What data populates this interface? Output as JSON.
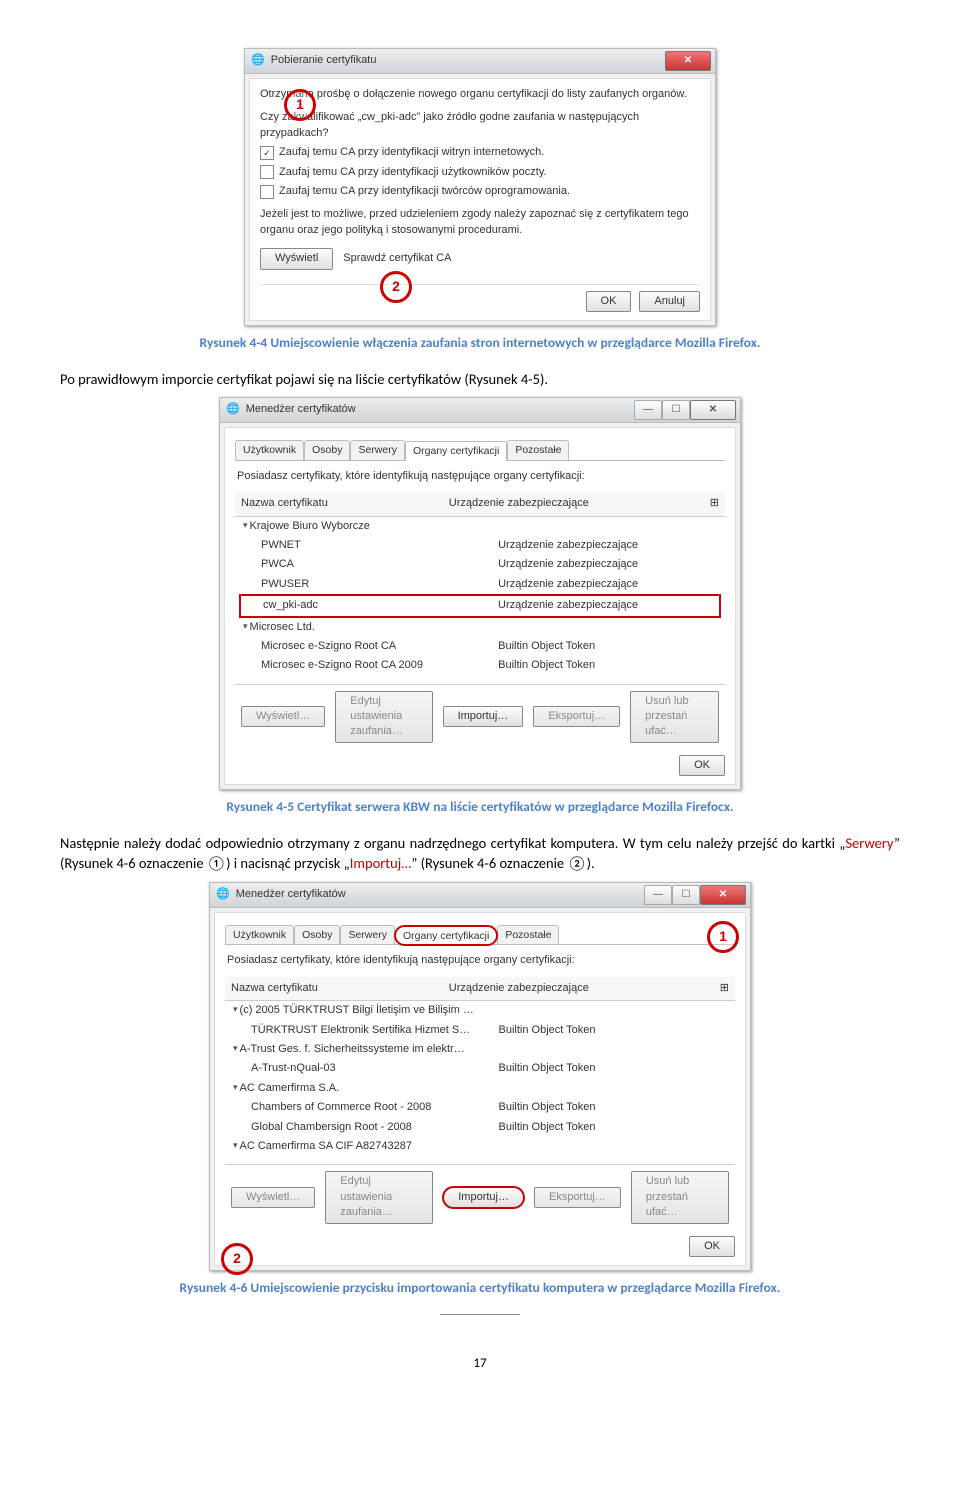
{
  "dialog1": {
    "title": "Pobieranie certyfikatu",
    "intro": "Otrzymano prośbę o dołączenie nowego organu certyfikacji do listy zaufanych organów.",
    "question": "Czy zakwalifikować „cw_pki-adc” jako źródło godne zaufania w następujących przypadkach?",
    "chk1": "Zaufaj temu CA przy identyfikacji witryn internetowych.",
    "chk2": "Zaufaj temu CA przy identyfikacji użytkowników poczty.",
    "chk3": "Zaufaj temu CA przy identyfikacji twórców oprogramowania.",
    "warn": "Jeżeli jest to możliwe, przed udzieleniem zgody należy zapoznać się z certyfikatem tego organu oraz jego polityką i stosowanymi procedurami.",
    "viewBtn": "Wyświetl",
    "verifyBtn": "Sprawdź certyfikat CA",
    "ok": "OK",
    "cancel": "Anuluj",
    "circle1": "1",
    "circle2": "2"
  },
  "caption1": "Rysunek 4-4 Umiejscowienie włączenia zaufania stron internetowych w przeglądarce Mozilla Firefox.",
  "para1": "Po prawidłowym imporcie certyfikat pojawi się na liście certyfikatów (Rysunek 4-5).",
  "dialog2": {
    "title": "Menedżer certyfikatów",
    "tabs": [
      "Użytkownik",
      "Osoby",
      "Serwery",
      "Organy certyfikacji",
      "Pozostałe"
    ],
    "desc": "Posiadasz certyfikaty, które identyfikują następujące organy certyfikacji:",
    "h1": "Nazwa certyfikatu",
    "h2": "Urządzenie zabezpieczające",
    "groups": [
      {
        "name": "Krajowe Biuro Wyborcze",
        "open": true,
        "items": [
          [
            "PWNET",
            "Urządzenie zabezpieczające"
          ],
          [
            "PWCA",
            "Urządzenie zabezpieczające"
          ],
          [
            "PWUSER",
            "Urządzenie zabezpieczające"
          ],
          [
            "cw_pki-adc",
            "Urządzenie zabezpieczające"
          ]
        ]
      },
      {
        "name": "Microsec Ltd.",
        "open": true,
        "items": [
          [
            "Microsec e-Szigno Root CA",
            "Builtin Object Token"
          ],
          [
            "Microsec e-Szigno Root CA 2009",
            "Builtin Object Token"
          ]
        ]
      }
    ],
    "btns": [
      "Wyświetl…",
      "Edytuj ustawienia zaufania…",
      "Importuj…",
      "Eksportuj…",
      "Usuń lub przestań ufać…"
    ],
    "ok": "OK"
  },
  "caption2": "Rysunek 4-5 Certyfikat serwera KBW na liście certyfikatów w przeglądarce Mozilla Firefocx.",
  "para2a": "Następnie należy dodać odpowiednio otrzymany z organu nadrzędnego certyfikat komputera. W tym celu należy przejść do kartki „",
  "para2serw": "Serwery",
  "para2b": "” (Rysunek 4-6 oznaczenie ①) i nacisnąć przycisk „",
  "para2imp": "Importuj…",
  "para2c": "” (Rysunek 4-6 oznaczenie ②).",
  "dialog3": {
    "title": "Menedżer certyfikatów",
    "tabs": [
      "Użytkownik",
      "Osoby",
      "Serwery",
      "Organy certyfikacji",
      "Pozostałe"
    ],
    "desc": "Posiadasz certyfikaty, które identyfikują następujące organy certyfikacji:",
    "h1": "Nazwa certyfikatu",
    "h2": "Urządzenie zabezpieczające",
    "groups": [
      {
        "name": "(c) 2005 TÜRKTRUST Bilgi İletişim ve Bilişim …",
        "open": true,
        "items": [
          [
            "TÜRKTRUST Elektronik Sertifika Hizmet S…",
            "Builtin Object Token"
          ]
        ]
      },
      {
        "name": "A-Trust Ges. f. Sicherheitssysteme im elektr…",
        "open": true,
        "items": [
          [
            "A-Trust-nQual-03",
            "Builtin Object Token"
          ]
        ]
      },
      {
        "name": "AC Camerfirma S.A.",
        "open": true,
        "items": [
          [
            "Chambers of Commerce Root - 2008",
            "Builtin Object Token"
          ],
          [
            "Global Chambersign Root - 2008",
            "Builtin Object Token"
          ]
        ]
      },
      {
        "name": "AC Camerfirma SA CIF A82743287",
        "open": true,
        "items": []
      }
    ],
    "btns": [
      "Wyświetl…",
      "Edytuj ustawienia zaufania…",
      "Importuj…",
      "Eksportuj…",
      "Usuń lub przestań ufać…"
    ],
    "ok": "OK",
    "circle1": "1",
    "circle2": "2"
  },
  "caption3": "Rysunek 4-6 Umiejscowienie przycisku importowania certyfikatu komputera w przeglądarce Mozilla Firefox.",
  "pagenum": "17"
}
